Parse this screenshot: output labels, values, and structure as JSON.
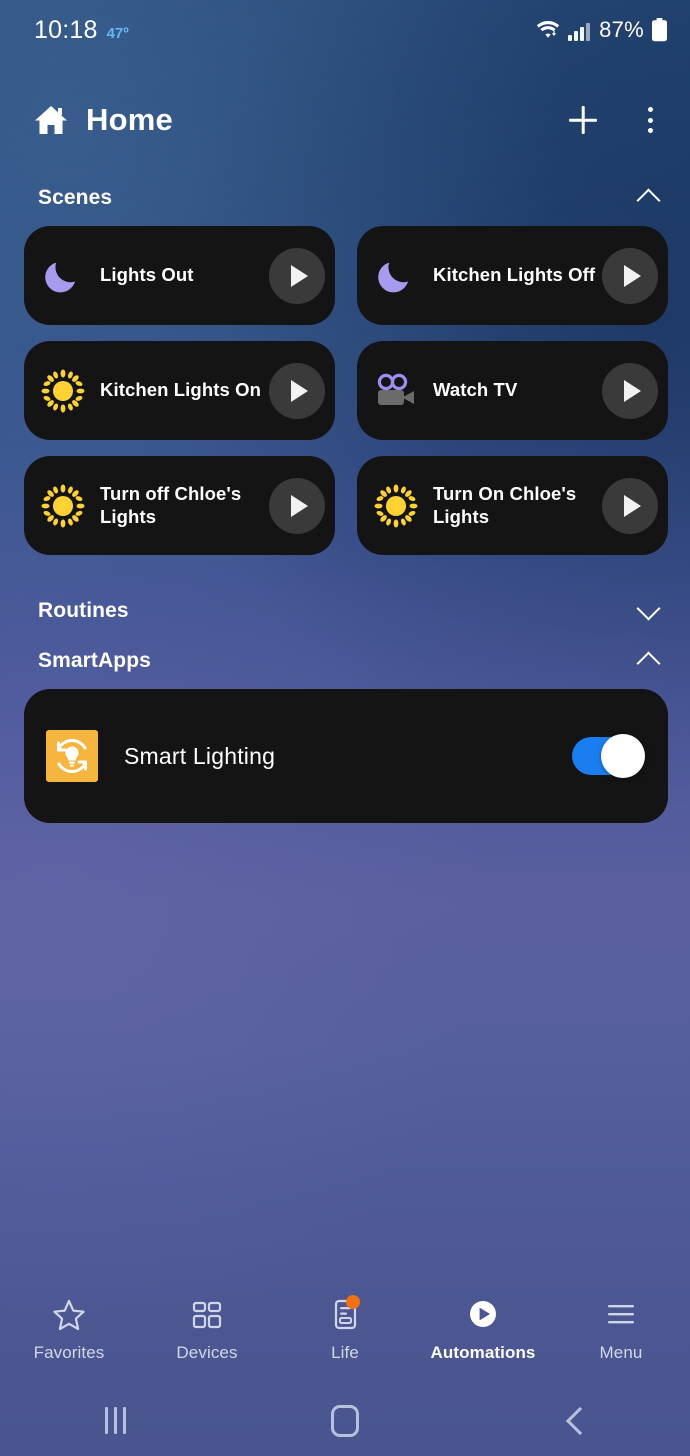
{
  "status_bar": {
    "time": "10:18",
    "temperature": "47º",
    "battery_percent": "87%",
    "icons": [
      "wifi-icon",
      "cellular-signal-icon",
      "battery-icon"
    ]
  },
  "app_bar": {
    "home_icon": "home-icon",
    "title": "Home",
    "add_label": "+",
    "more_label": "⋮"
  },
  "sections": {
    "scenes": {
      "title": "Scenes",
      "expanded": true,
      "chevron": "chevron-up-icon"
    },
    "routines": {
      "title": "Routines",
      "expanded": false,
      "chevron": "chevron-down-icon"
    },
    "smartapps": {
      "title": "SmartApps",
      "expanded": true,
      "chevron": "chevron-up-icon"
    }
  },
  "scenes": [
    {
      "name": "Lights Out",
      "icon": "moon-icon",
      "icon_color": "#a79bf0",
      "play": "play-icon"
    },
    {
      "name": "Kitchen Lights Off",
      "icon": "moon-icon",
      "icon_color": "#a79bf0",
      "play": "play-icon"
    },
    {
      "name": "Kitchen Lights On",
      "icon": "sun-icon",
      "icon_color": "#ffd233",
      "play": "play-icon"
    },
    {
      "name": "Watch TV",
      "icon": "video-camera-icon",
      "icon_color": "#9b8ef0",
      "play": "play-icon"
    },
    {
      "name": "Turn off Chloe's Lights",
      "icon": "sun-icon",
      "icon_color": "#ffd233",
      "play": "play-icon"
    },
    {
      "name": "Turn On Chloe's Lights",
      "icon": "sun-icon",
      "icon_color": "#ffd233",
      "play": "play-icon"
    }
  ],
  "smartapps": [
    {
      "name": "Smart Lighting",
      "icon": "smart-lighting-icon",
      "icon_bg": "#f5b53f",
      "toggle_on": true,
      "toggle_color": "#1a7ef0"
    }
  ],
  "bottom_nav": {
    "active": "Automations",
    "items": [
      {
        "label": "Favorites",
        "icon": "star-icon",
        "badge": false
      },
      {
        "label": "Devices",
        "icon": "grid-icon",
        "badge": false
      },
      {
        "label": "Life",
        "icon": "document-icon",
        "badge": true
      },
      {
        "label": "Automations",
        "icon": "play-circle-icon",
        "badge": false
      },
      {
        "label": "Menu",
        "icon": "hamburger-icon",
        "badge": false
      }
    ],
    "badge_color": "#f2700f"
  },
  "system_nav": {
    "recents": "recents-icon",
    "home": "home-square-icon",
    "back": "back-icon"
  },
  "colors": {
    "card_bg": "#141414",
    "accent_blue": "#1a7ef0",
    "temp_blue": "#62b9f2",
    "badge_orange": "#f2700f"
  }
}
